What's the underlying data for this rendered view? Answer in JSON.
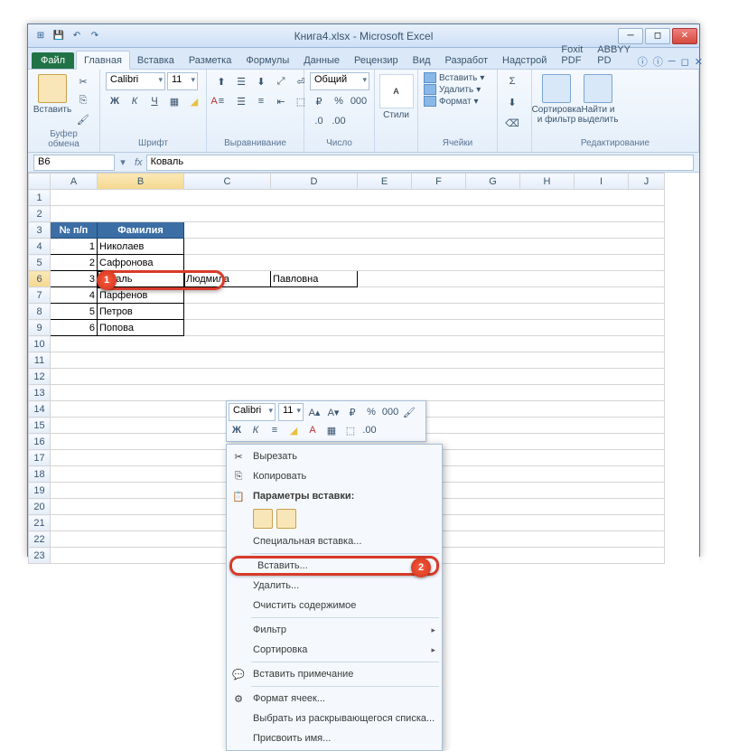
{
  "title": "Книга4.xlsx - Microsoft Excel",
  "file_tab": "Файл",
  "tabs": {
    "home": "Главная",
    "insert": "Вставка",
    "layout": "Разметка",
    "formulas": "Формулы",
    "data": "Данные",
    "review": "Рецензир",
    "view": "Вид",
    "dev": "Разработ",
    "addins": "Надстрой",
    "foxit": "Foxit PDF",
    "abbyy": "ABBYY PD"
  },
  "ribbon": {
    "clipboard": {
      "paste": "Вставить",
      "label": "Буфер обмена"
    },
    "font": {
      "name": "Calibri",
      "size": "11",
      "label": "Шрифт"
    },
    "align": {
      "label": "Выравнивание"
    },
    "number": {
      "fmt": "Общий",
      "label": "Число"
    },
    "styles": {
      "btn": "Стили",
      "label": "Стили"
    },
    "cells": {
      "insert": "Вставить",
      "delete": "Удалить",
      "format": "Формат",
      "label": "Ячейки"
    },
    "editing": {
      "sort": "Сортировка и фильтр",
      "find": "Найти и выделить",
      "label": "Редактирование"
    }
  },
  "namebox": "B6",
  "formula": "Коваль",
  "cols": [
    "A",
    "B",
    "C",
    "D",
    "E",
    "F",
    "G",
    "H",
    "I",
    "J"
  ],
  "headers": {
    "num": "№ п/п",
    "fam": "Фамилия",
    "otch": "Павловна"
  },
  "rows": [
    {
      "n": "1",
      "f": "Николаев"
    },
    {
      "n": "2",
      "f": "Сафронова"
    },
    {
      "n": "3",
      "f": "Коваль",
      "c": "Людмила",
      "d": "Павловна"
    },
    {
      "n": "4",
      "f": "Парфенов"
    },
    {
      "n": "5",
      "f": "Петров"
    },
    {
      "n": "6",
      "f": "Попова"
    }
  ],
  "markers": {
    "m1": "1",
    "m2": "2"
  },
  "mini": {
    "font": "Calibri",
    "size": "11"
  },
  "ctx": {
    "cut": "Вырезать",
    "copy": "Копировать",
    "pasteopts": "Параметры вставки:",
    "pspecial": "Специальная вставка...",
    "insert": "Вставить...",
    "delete": "Удалить...",
    "clear": "Очистить содержимое",
    "filter": "Фильтр",
    "sort": "Сортировка",
    "comment": "Вставить примечание",
    "fmt": "Формат ячеек...",
    "dropdown": "Выбрать из раскрывающегося списка...",
    "name": "Присвоить имя..."
  }
}
